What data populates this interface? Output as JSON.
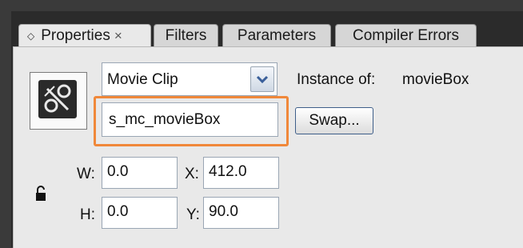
{
  "tabs": [
    {
      "label": "Properties",
      "active": true
    },
    {
      "label": "Filters"
    },
    {
      "label": "Parameters"
    },
    {
      "label": "Compiler Errors"
    }
  ],
  "symbol_type": {
    "value": "Movie Clip"
  },
  "instance_of": {
    "label": "Instance of:",
    "value": "movieBox"
  },
  "instance_name": {
    "value": "s_mc_movieBox"
  },
  "swap_button": {
    "label": "Swap..."
  },
  "dimensions": {
    "w_label": "W:",
    "w_value": "0.0",
    "h_label": "H:",
    "h_value": "0.0",
    "x_label": "X:",
    "x_value": "412.0",
    "y_label": "Y:",
    "y_value": "90.0"
  },
  "icons": {
    "tab_diamond": "diamond-icon",
    "tab_close": "close-icon",
    "symbol": "movie-clip-symbol-icon",
    "dropdown": "chevron-down-icon",
    "lock": "lock-icon"
  },
  "colors": {
    "highlight": "#f0883a",
    "panel": "#e9e9e9",
    "background": "#2b2b2b"
  }
}
